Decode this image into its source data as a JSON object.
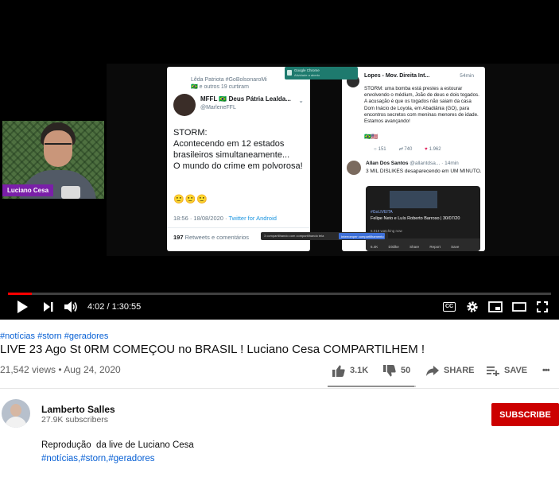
{
  "player": {
    "time_display": "4:02 / 1:30:55",
    "progress_fraction": 0.044,
    "accent_color": "#ff0000",
    "controls": [
      "play-icon",
      "next-icon",
      "volume-icon",
      "captions-icon",
      "settings-icon",
      "miniplayer-icon",
      "theater-icon",
      "fullscreen-icon"
    ],
    "captions_label": "CC"
  },
  "stream": {
    "presenter_tag": "Luciano Cesa",
    "tweet_left": {
      "liked_line1": "Lêda Patriota #GoBolsonaroMi",
      "liked_line2": "🇧🇷 e outros 19 curtiram",
      "name": "MFFL 🇧🇷 Deus Pátria Lealda...",
      "handle": "@MarleneFFL",
      "body": "STORM:\nAcontecendo em 12 estados brasileiros simultaneamente...\nO mundo do crime em polvorosa!",
      "emoji": "🙂🙂🙂",
      "time": "18:56 · 18/08/2020 · ",
      "source": "Twitter for Android",
      "retweets": "197",
      "retweets_label": " Retweets e comentários"
    },
    "tweet_right": {
      "name": "Lopes - Mov. Direita Int...",
      "time": "54min",
      "body": "STORM: uma bomba está prestes a estourar envolvendo o médium, João de deus e dois togados. A acusação é que os togados não saiam da casa Dom Inácio de Loyola, em Abadiânia (GO), para encontros secretos com meninas menores de idade. Estamos avançando!",
      "flags": "🇧🇷🇺🇸",
      "replies": "151",
      "retweets": "740",
      "likes": "1.962",
      "reply2_name": "Allan Dos Santos",
      "reply2_handle": " @allantdsa... · 14min",
      "reply2_body": "3 MIL DISLIKES desaparecendo em UM MINUTO.",
      "video_tag": "#GoLIVEITA",
      "video_title": "Felipe Neto e Luís Roberto Barroso | 30/07/20",
      "video_views": "6.019 watching now",
      "video_actions": [
        "6.4K",
        "Dislike",
        "Share",
        "Report",
        "Save"
      ]
    },
    "popup_line1": "Google Chrome",
    "popup_line2": "Atividade a aberto",
    "share_text": "3 compartilhando com compartilhando tela",
    "share_button": "Interromper compartilhamento"
  },
  "video": {
    "hashtags": "#notícias #storn #geradores",
    "title": "LIVE 23 Ago St 0RM COMEÇOU no BRASIL ! Luciano Cesa COMPARTILHEM !",
    "views": "21,542 views",
    "date": "Aug 24, 2020",
    "views_date_separator": " • ",
    "likes": "3.1K",
    "dislikes": "50",
    "like_fraction": 0.984,
    "share_label": "SHARE",
    "save_label": "SAVE",
    "more_label": "•••"
  },
  "channel": {
    "name": "Lamberto Salles",
    "subscribers": "27.9K subscribers",
    "subscribe_label": "SUBSCRIBE",
    "subscribe_color": "#cc0000"
  },
  "description": {
    "text": "Reprodução  da live de Luciano Cesa",
    "tags": "#notícias,#storn,#geradores"
  }
}
